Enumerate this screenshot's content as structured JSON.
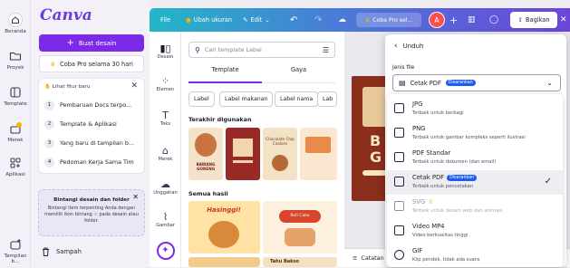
{
  "rail": {
    "items": [
      {
        "label": "Beranda",
        "icon": "home-icon"
      },
      {
        "label": "Proyek",
        "icon": "folder-icon"
      },
      {
        "label": "Template",
        "icon": "template-icon"
      },
      {
        "label": "Merek",
        "icon": "brand-icon"
      },
      {
        "label": "Aplikasi",
        "icon": "apps-icon"
      },
      {
        "label": "Tampilan b...",
        "icon": "sparkle-icon"
      }
    ]
  },
  "panel": {
    "logo": "Canva",
    "create_label": "Buat desain",
    "pro_label": "Coba Pro selama 30 hari",
    "whats_new": {
      "header": "Lihat fitur baru",
      "items": [
        {
          "num": "1",
          "label": "Pembaruan Docs terpo..."
        },
        {
          "num": "2",
          "label": "Template & Aplikasi"
        },
        {
          "num": "3",
          "label": "Yang baru di tampilan b..."
        },
        {
          "num": "4",
          "label": "Pedoman Kerja Sama Tim"
        }
      ]
    },
    "star_card": {
      "title": "Bintangi desain dan folder",
      "desc": "Bintangi item terpenting Anda dengan memilih ikon bintang ☆ pada desain atau folder."
    },
    "trash_label": "Sampah"
  },
  "topbar": {
    "file": "File",
    "resize": "Ubah ukuran",
    "edit": "Edit",
    "pro_chip": "Coba Pro sel...",
    "avatar": "A",
    "share": "Bagikan"
  },
  "tools": [
    {
      "label": "Desain"
    },
    {
      "label": "Elemen"
    },
    {
      "label": "Teks"
    },
    {
      "label": "Merek"
    },
    {
      "label": "Unggahan"
    },
    {
      "label": "Gambar"
    }
  ],
  "templates": {
    "search_placeholder": "Cari template Label",
    "tabs": [
      "Template",
      "Gaya"
    ],
    "chips": [
      "Label",
      "Label makanan",
      "Label nama",
      "Lab"
    ],
    "recent_title": "Terakhir digunakan",
    "all_title": "Semua hasil",
    "tile_texts": [
      "BAWANG GORENG",
      "Chocolate Chip Cookies",
      "Hasinggi!",
      "Roll Cake",
      "Tahu Bakso"
    ]
  },
  "canvas": {
    "card_letters": [
      "B",
      "G"
    ],
    "notes_label": "Catatan"
  },
  "download": {
    "title": "Unduh",
    "file_type_label": "Jenis file",
    "selected": "Cetak PDF",
    "selected_badge": "Disarankan",
    "options": [
      {
        "name": "JPG",
        "desc": "Terbaik untuk berbagi",
        "badge": "",
        "selected": false
      },
      {
        "name": "PNG",
        "desc": "Terbaik untuk gambar kompleks seperti ilustrasi",
        "badge": "",
        "selected": false
      },
      {
        "name": "PDF Standar",
        "desc": "Terbaik untuk dokumen (dan email)",
        "badge": "",
        "selected": false
      },
      {
        "name": "Cetak PDF",
        "desc": "Terbaik untuk pencetakan",
        "badge": "Disarankan",
        "selected": true
      },
      {
        "name": "SVG",
        "desc": "Terbaik untuk desain web dan animasi",
        "badge": "",
        "selected": false
      },
      {
        "name": "Video MP4",
        "desc": "Video berkualitas tinggi",
        "badge": "",
        "selected": false
      },
      {
        "name": "GIF",
        "desc": "Klip pendek, tidak ada suara",
        "badge": "",
        "selected": false
      }
    ]
  },
  "colors": {
    "accent": "#7d2ae8",
    "badge": "#1e5df0",
    "avatar": "#ff4d4d"
  }
}
